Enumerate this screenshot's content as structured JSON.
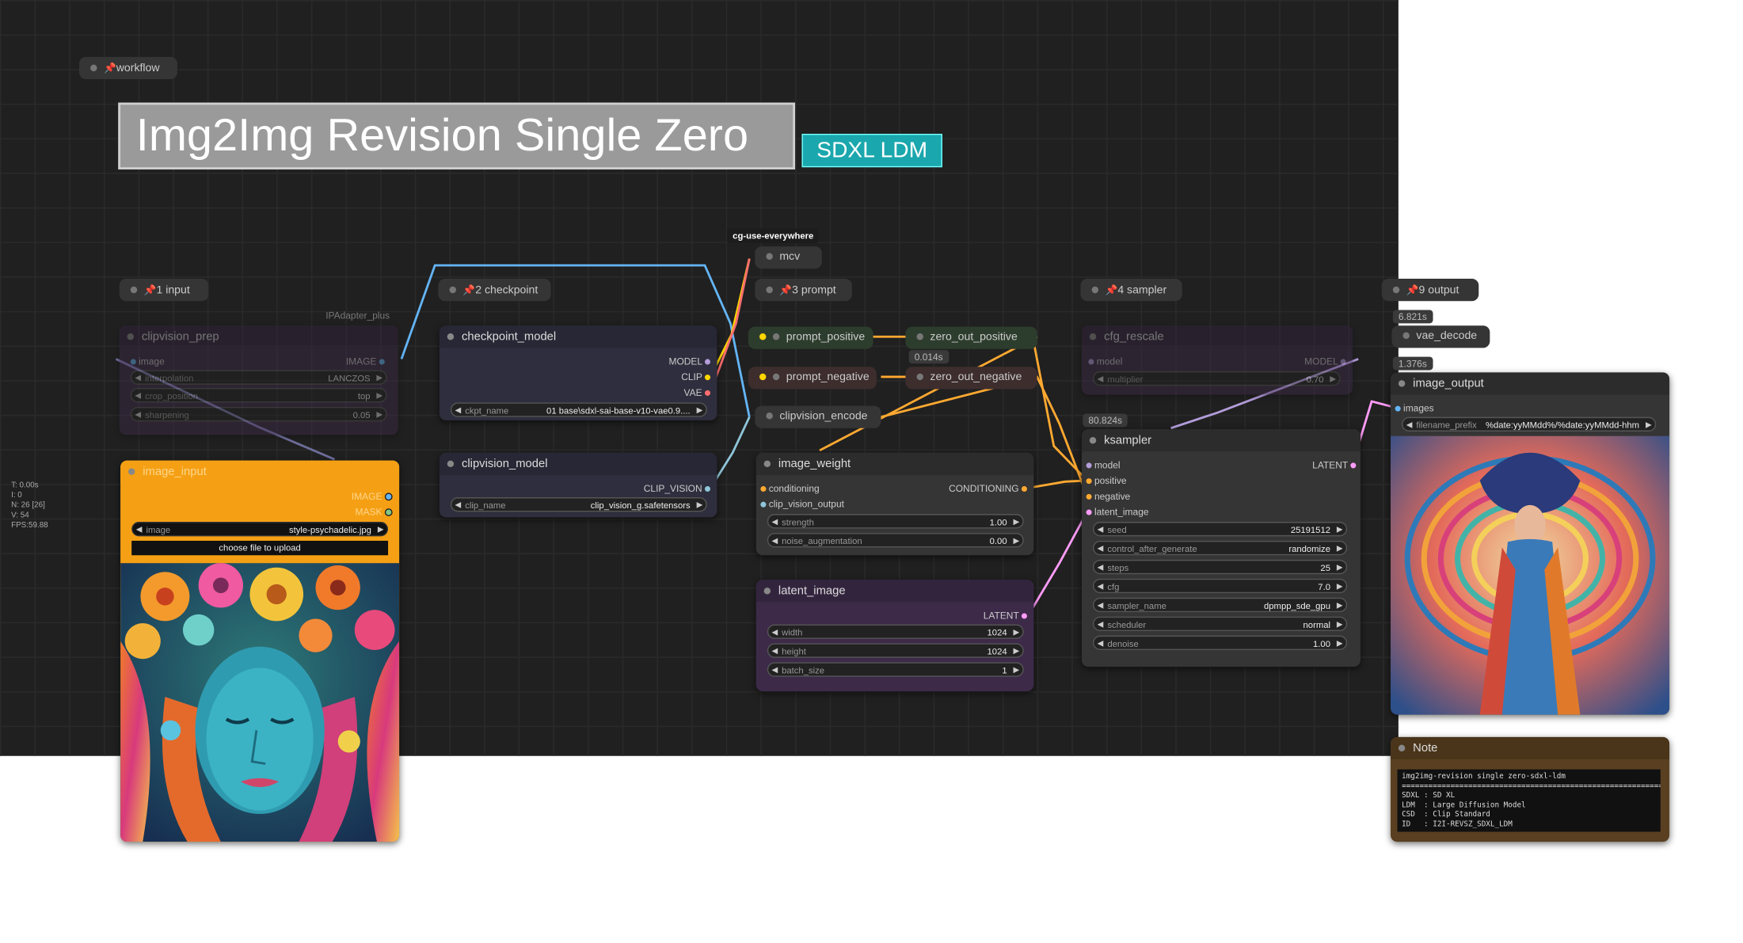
{
  "title": "Img2Img Revision Single Zero",
  "title_tag": "SDXL LDM",
  "plugin_tag": "cg-use-everywhere",
  "stats": [
    "T: 0.00s",
    "I: 0",
    "N: 26 [26]",
    "V: 54",
    "FPS:59.88"
  ],
  "groups": {
    "workflow": "workflow",
    "input": "1 input",
    "checkpoint": "2 checkpoint",
    "prompt": "3 prompt",
    "sampler": "4 sampler",
    "output": "9 output"
  },
  "ipadapter_label": "IPAdapter_plus",
  "clipvision_prep": {
    "title": "clipvision_prep",
    "input": "image",
    "output": "IMAGE",
    "interpolation": {
      "label": "interpolation",
      "value": "LANCZOS"
    },
    "crop_position": {
      "label": "crop_position",
      "value": "top"
    },
    "sharpening": {
      "label": "sharpening",
      "value": "0.05"
    }
  },
  "image_input": {
    "title": "image_input",
    "out_image": "IMAGE",
    "out_mask": "MASK",
    "image": {
      "label": "image",
      "value": "style-psychadelic.jpg"
    },
    "upload": "choose file to upload"
  },
  "checkpoint_model": {
    "title": "checkpoint_model",
    "outputs": [
      "MODEL",
      "CLIP",
      "VAE"
    ],
    "ckpt_name": {
      "label": "ckpt_name",
      "value": "01 base\\sdxl-sai-base-v10-vae0.9...."
    }
  },
  "clipvision_model": {
    "title": "clipvision_model",
    "output": "CLIP_VISION",
    "clip_name": {
      "label": "clip_name",
      "value": "clip_vision_g.safetensors"
    }
  },
  "mcv": "mcv",
  "prompt_positive": "prompt_positive",
  "prompt_negative": "prompt_negative",
  "zero_out_positive": "zero_out_positive",
  "zero_out_negative": "zero_out_negative",
  "zero_time": "0.014s",
  "clipvision_encode": "clipvision_encode",
  "image_weight": {
    "title": "image_weight",
    "in_conditioning": "conditioning",
    "in_clip_vision_output": "clip_vision_output",
    "out": "CONDITIONING",
    "strength": {
      "label": "strength",
      "value": "1.00"
    },
    "noise_augmentation": {
      "label": "noise_augmentation",
      "value": "0.00"
    }
  },
  "latent_image": {
    "title": "latent_image",
    "out": "LATENT",
    "width": {
      "label": "width",
      "value": "1024"
    },
    "height": {
      "label": "height",
      "value": "1024"
    },
    "batch_size": {
      "label": "batch_size",
      "value": "1"
    }
  },
  "cfg_rescale": {
    "title": "cfg_rescale",
    "input": "model",
    "output": "MODEL",
    "multiplier": {
      "label": "multiplier",
      "value": "0.70"
    }
  },
  "ksampler": {
    "title": "ksampler",
    "time": "80.824s",
    "inputs": [
      "model",
      "positive",
      "negative",
      "latent_image"
    ],
    "out": "LATENT",
    "seed": {
      "label": "seed",
      "value": "25191512"
    },
    "control_after_generate": {
      "label": "control_after_generate",
      "value": "randomize"
    },
    "steps": {
      "label": "steps",
      "value": "25"
    },
    "cfg": {
      "label": "cfg",
      "value": "7.0"
    },
    "sampler_name": {
      "label": "sampler_name",
      "value": "dpmpp_sde_gpu"
    },
    "scheduler": {
      "label": "scheduler",
      "value": "normal"
    },
    "denoise": {
      "label": "denoise",
      "value": "1.00"
    }
  },
  "vae_decode": {
    "title": "vae_decode",
    "time": "6.821s"
  },
  "image_output": {
    "title": "image_output",
    "time": "1.376s",
    "input": "images",
    "filename_prefix": {
      "label": "filename_prefix",
      "value": "%date:yyMMdd%/%date:yyMMdd-hhm"
    }
  },
  "note": {
    "title": "Note",
    "lines": [
      "img2img-revision single zero-sdxl-ldm",
      "==============================================================",
      "SDXL : SD XL",
      "LDM  : Large Diffusion Model",
      "CSD  : Clip Standard",
      "ID   : I2I-REVSZ_SDXL_LDM"
    ]
  },
  "colors": {
    "canvas": "#202020",
    "model_wire": "#b39ddb",
    "clip_wire": "#ffd500",
    "vae_wire": "#ff6e6e",
    "image_wire": "#64b5f6",
    "conditioning_wire": "#ffa931",
    "latent_wire": "#ff9cf9",
    "image_input_header": "#f5a014",
    "title_tag": "#1aa7ad"
  }
}
